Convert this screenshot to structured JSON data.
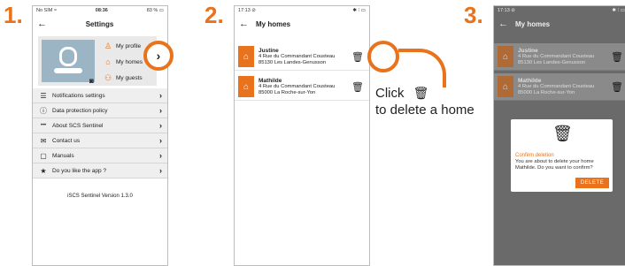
{
  "steps": [
    "1.",
    "2.",
    "3."
  ],
  "phone1": {
    "status_left": "No SIM ≈",
    "status_time": "08:36",
    "status_right": "83 % ▭",
    "title": "Settings",
    "profile_menu": [
      {
        "icon": "♙",
        "label": "My profile"
      },
      {
        "icon": "⌂",
        "label": "My homes"
      },
      {
        "icon": "⚇",
        "label": "My guests"
      }
    ],
    "menu": [
      {
        "icon": "☰",
        "label": "Notifications settings"
      },
      {
        "icon": "ⓘ",
        "label": "Data protection policy"
      },
      {
        "icon": "•••",
        "label": "About SCS Sentinel"
      },
      {
        "icon": "✉",
        "label": "Contact us"
      },
      {
        "icon": "▢",
        "label": "Manuals"
      },
      {
        "icon": "★",
        "label": "Do you like the app ?"
      }
    ],
    "version": "iSCS Sentinel Version 1.3.0"
  },
  "phone2": {
    "status_left": "17:13 ⊘",
    "status_right": "✱ ⁝ ▭",
    "title": "My homes",
    "homes": [
      {
        "name": "Justine",
        "address1": "4 Rue du Commandant Cousteau",
        "address2": "85130 Les Landes-Genusson"
      },
      {
        "name": "Mathilde",
        "address1": "4 Rue du Commandant Cousteau",
        "address2": "85000 La Roche-sur-Yon"
      }
    ]
  },
  "callout": {
    "line1": "Click",
    "icon": "🗑",
    "line2": "to delete a home"
  },
  "phone3": {
    "status_left": "17:13 ⊘",
    "status_right": "✱ ⁝ ▭",
    "title": "My homes",
    "homes": [
      {
        "name": "Justine",
        "address1": "4 Rue du Commandant Cousteau",
        "address2": "85130 Les Landes-Genusson"
      },
      {
        "name": "Mathilde",
        "address1": "4 Rue du Commandant Cousteau",
        "address2": "85000 La Roche-sur-Yon"
      }
    ],
    "dialog": {
      "title": "Confirm deletion",
      "text": "You are about to delete your home Mathilde. Do you want to confirm?",
      "button": "DELETE"
    }
  },
  "colors": {
    "accent": "#e8731c"
  }
}
